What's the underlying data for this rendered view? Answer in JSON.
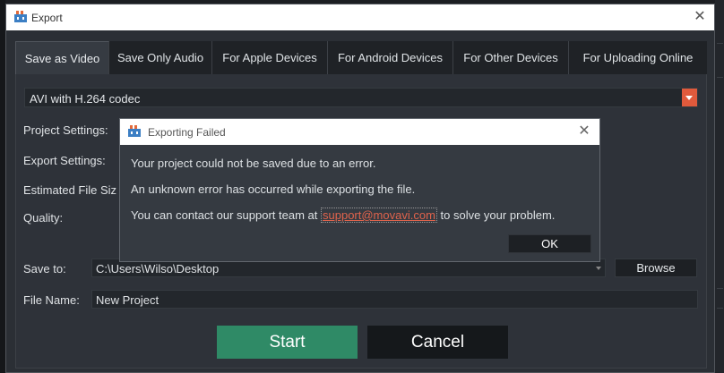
{
  "window": {
    "title": "Export",
    "close_glyph": "✕",
    "icon": "movavi-app-icon"
  },
  "tabs": [
    {
      "label": "Save as Video",
      "active": true
    },
    {
      "label": "Save Only Audio",
      "active": false
    },
    {
      "label": "For Apple Devices",
      "active": false
    },
    {
      "label": "For Android Devices",
      "active": false
    },
    {
      "label": "For Other Devices",
      "active": false
    },
    {
      "label": "For Uploading Online",
      "active": false
    }
  ],
  "form": {
    "codec": "AVI with H.264 codec",
    "project_settings_label": "Project Settings:",
    "export_settings_label": "Export Settings:",
    "estimated_size_label": "Estimated File Siz",
    "quality_label": "Quality:",
    "save_to_label": "Save to:",
    "save_to_value": "C:\\Users\\Wilso\\Desktop",
    "browse_label": "Browse",
    "file_name_label": "File Name:",
    "file_name_value": "New Project",
    "start_label": "Start",
    "cancel_label": "Cancel"
  },
  "dialog": {
    "title": "Exporting Failed",
    "close_glyph": "✕",
    "line1": "Your project could not be saved due to an error.",
    "line2": "An unknown error has occurred while exporting the file.",
    "line3_prefix": "You can contact our support team at ",
    "line3_link": "support@movavi.com",
    "line3_suffix": " to solve your problem.",
    "ok_label": "OK"
  },
  "colors": {
    "accent_start": "#2f8a66",
    "dropdown_accent": "#e05a3c",
    "link": "#e0634c"
  }
}
